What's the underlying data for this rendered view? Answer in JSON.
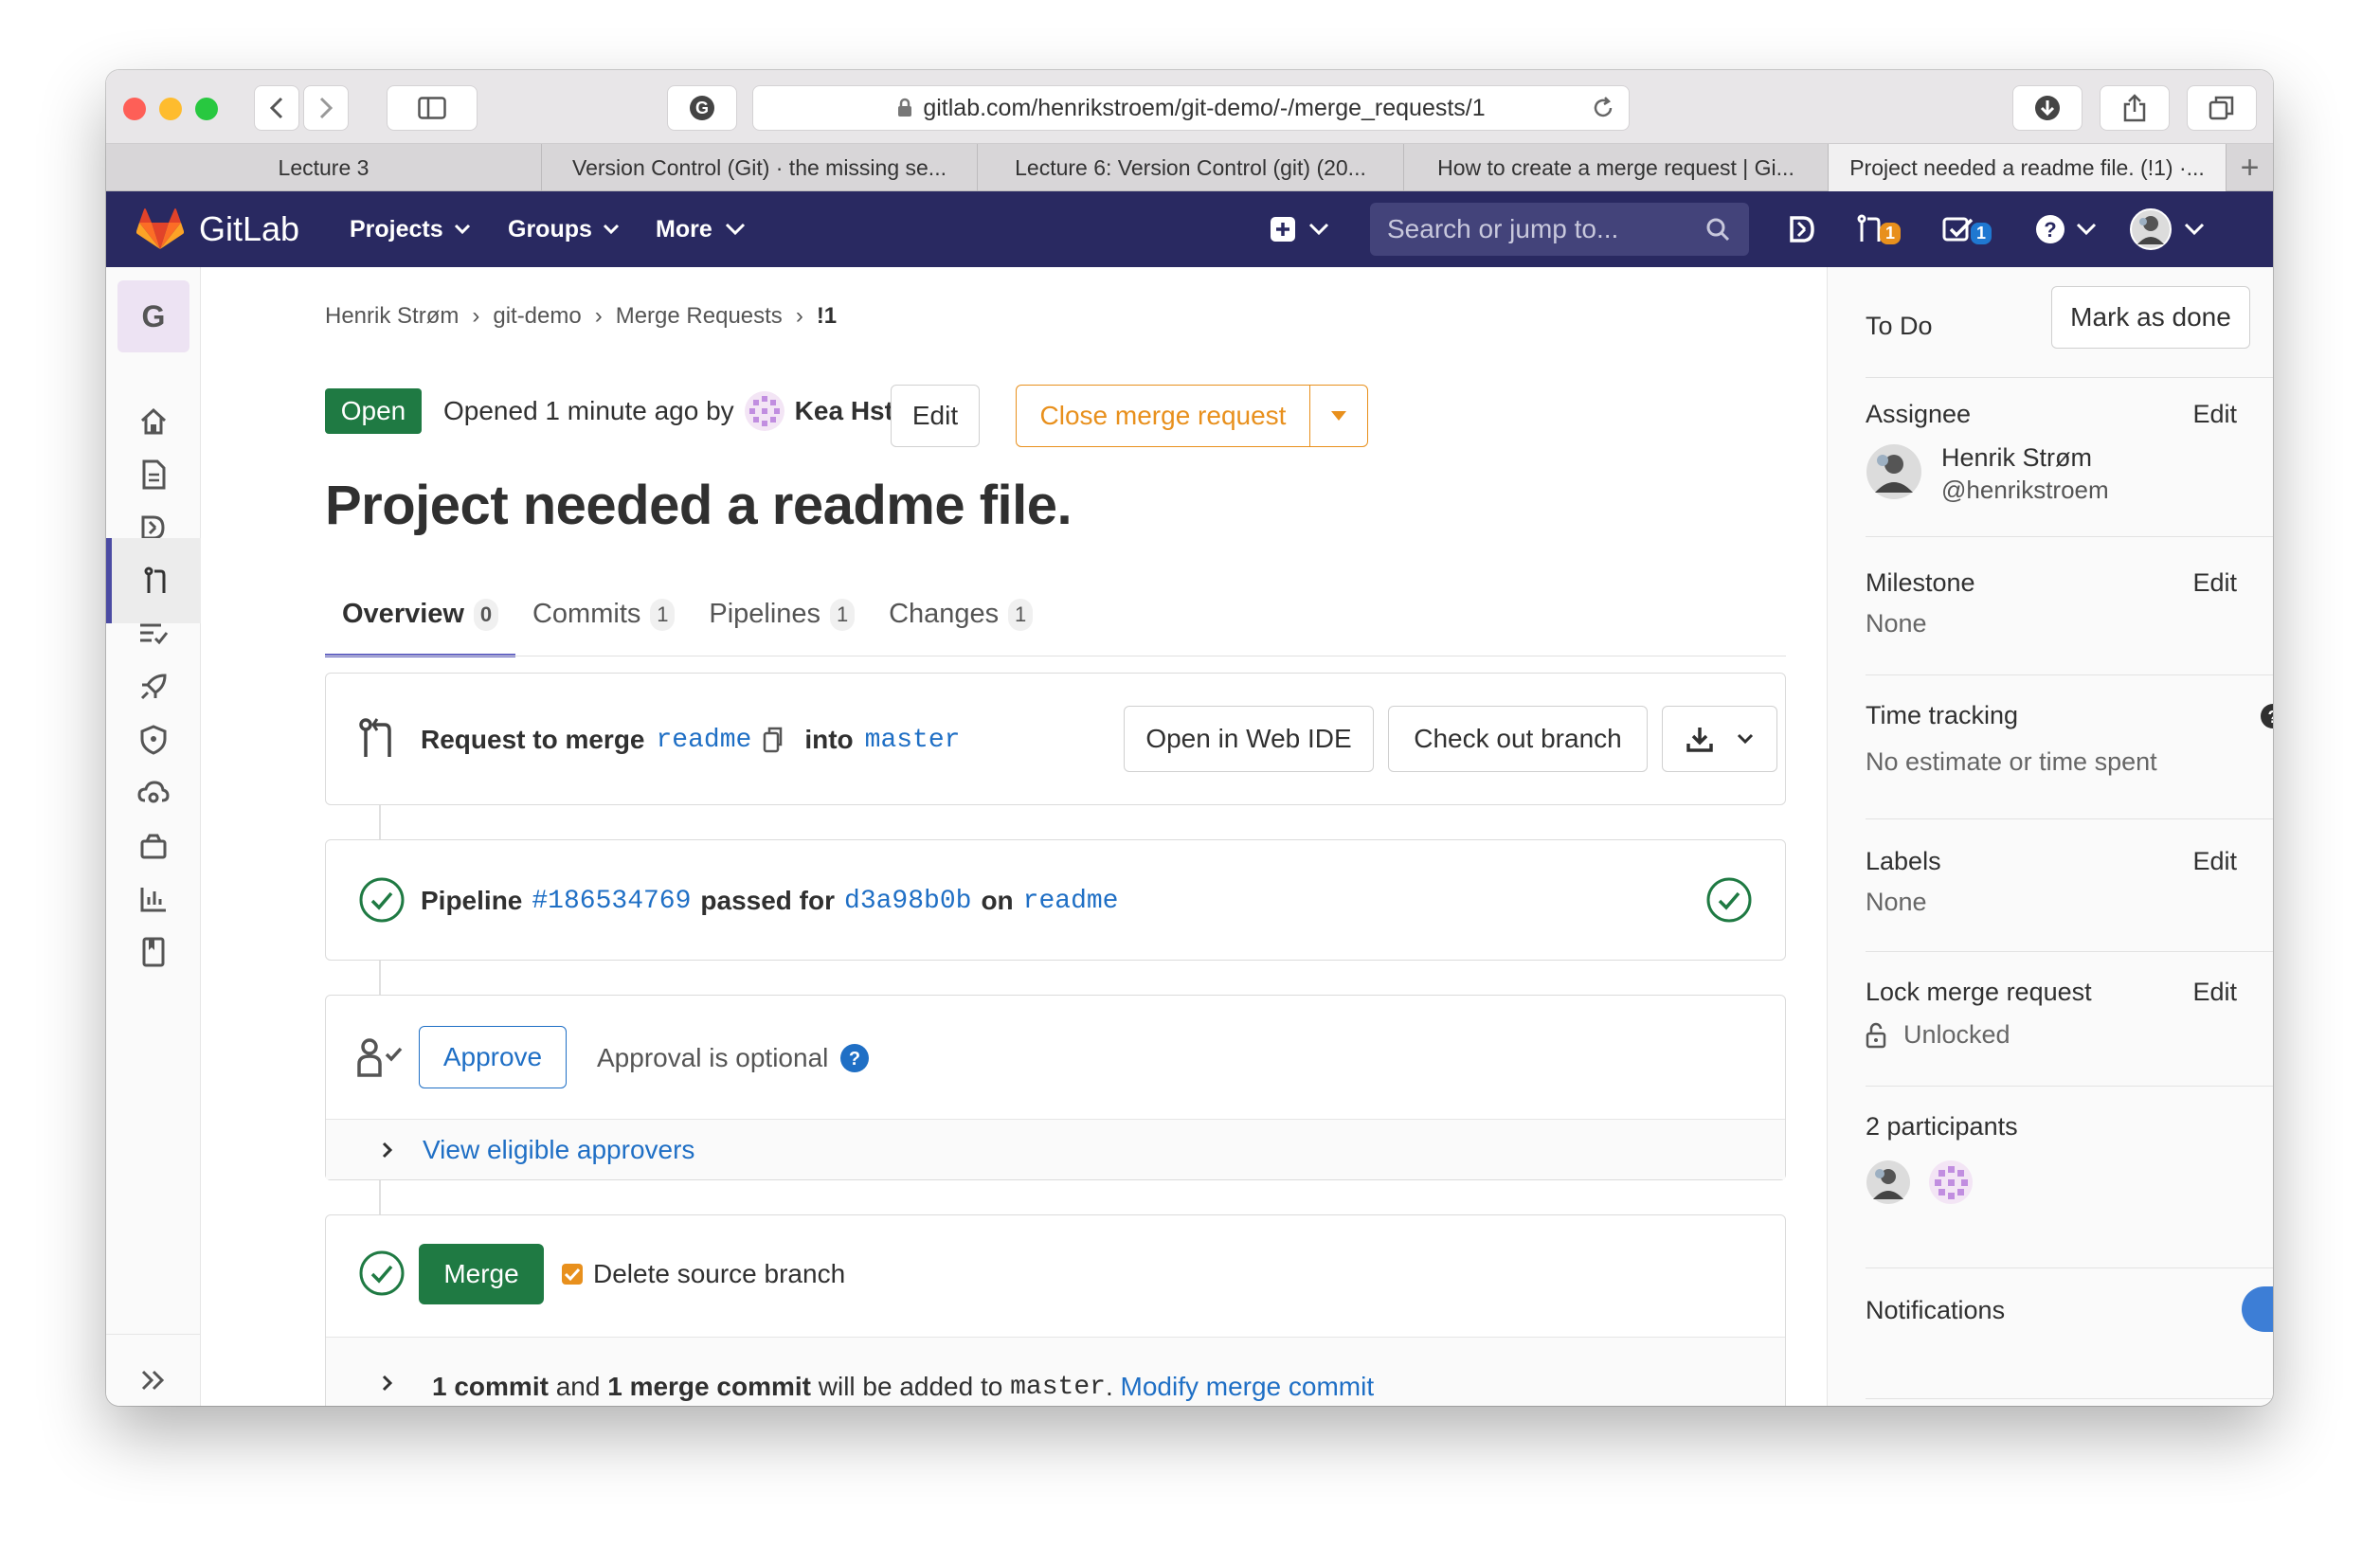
{
  "browser": {
    "url": "gitlab.com/henrikstroem/git-demo/-/merge_requests/1",
    "tabs": [
      {
        "title": "Lecture 3"
      },
      {
        "title": "Version Control (Git) · the missing se..."
      },
      {
        "title": "Lecture 6: Version Control (git) (20..."
      },
      {
        "title": "How to create a merge request | Gi..."
      },
      {
        "title": "Project needed a readme file. (!1) ·..."
      }
    ],
    "new_tab": "+"
  },
  "gitlab_nav": {
    "brand": "GitLab",
    "projects": "Projects",
    "groups": "Groups",
    "more": "More",
    "search_placeholder": "Search or jump to...",
    "mr_count": "1",
    "todo_count": "1"
  },
  "project_avatar_letter": "G",
  "breadcrumb": [
    "Henrik Strøm",
    "git-demo",
    "Merge Requests",
    "!1"
  ],
  "breadcrumb_sep": "›",
  "mr": {
    "status": "Open",
    "opened_text": "Opened 1 minute ago by",
    "author": "Kea Hstr",
    "edit_label": "Edit",
    "close_label": "Close merge request",
    "title": "Project needed a readme file.",
    "tabs": [
      {
        "label": "Overview",
        "count": "0"
      },
      {
        "label": "Commits",
        "count": "1"
      },
      {
        "label": "Pipelines",
        "count": "1"
      },
      {
        "label": "Changes",
        "count": "1"
      }
    ],
    "request_prefix": "Request to merge",
    "source_branch": "readme",
    "into_word": "into",
    "target_branch": "master",
    "open_web_ide": "Open in Web IDE",
    "checkout_branch": "Check out branch",
    "pipeline_word": "Pipeline",
    "pipeline_id": "#186534769",
    "passed_for": "passed for",
    "commit_sha": "d3a98b0b",
    "on_word": "on",
    "pipeline_branch": "readme",
    "approve_label": "Approve",
    "approval_optional": "Approval is optional",
    "view_approvers": "View eligible approvers",
    "merge_label": "Merge",
    "delete_source": "Delete source branch",
    "commit_count": "1 commit",
    "and_word": "and",
    "merge_commit_count": "1 merge commit",
    "will_be_added": "will be added to",
    "target_mono": "master",
    "period": ".",
    "modify_merge_commit": "Modify merge commit"
  },
  "sidebar": {
    "todo_label": "To Do",
    "mark_done": "Mark as done",
    "assignee_label": "Assignee",
    "edit": "Edit",
    "assignee_name": "Henrik Strøm",
    "assignee_handle": "@henrikstroem",
    "milestone_label": "Milestone",
    "milestone_value": "None",
    "time_tracking_label": "Time tracking",
    "time_tracking_value": "No estimate or time spent",
    "labels_label": "Labels",
    "labels_value": "None",
    "lock_label": "Lock merge request",
    "lock_value": "Unlocked",
    "participants_label": "2 participants",
    "notifications_label": "Notifications"
  },
  "colors": {
    "nav_bg": "#292961",
    "open_green": "#1f7a43",
    "link_blue": "#1f6fc5",
    "close_orange": "#e8901d",
    "toggle_blue": "#3d7ed6"
  }
}
